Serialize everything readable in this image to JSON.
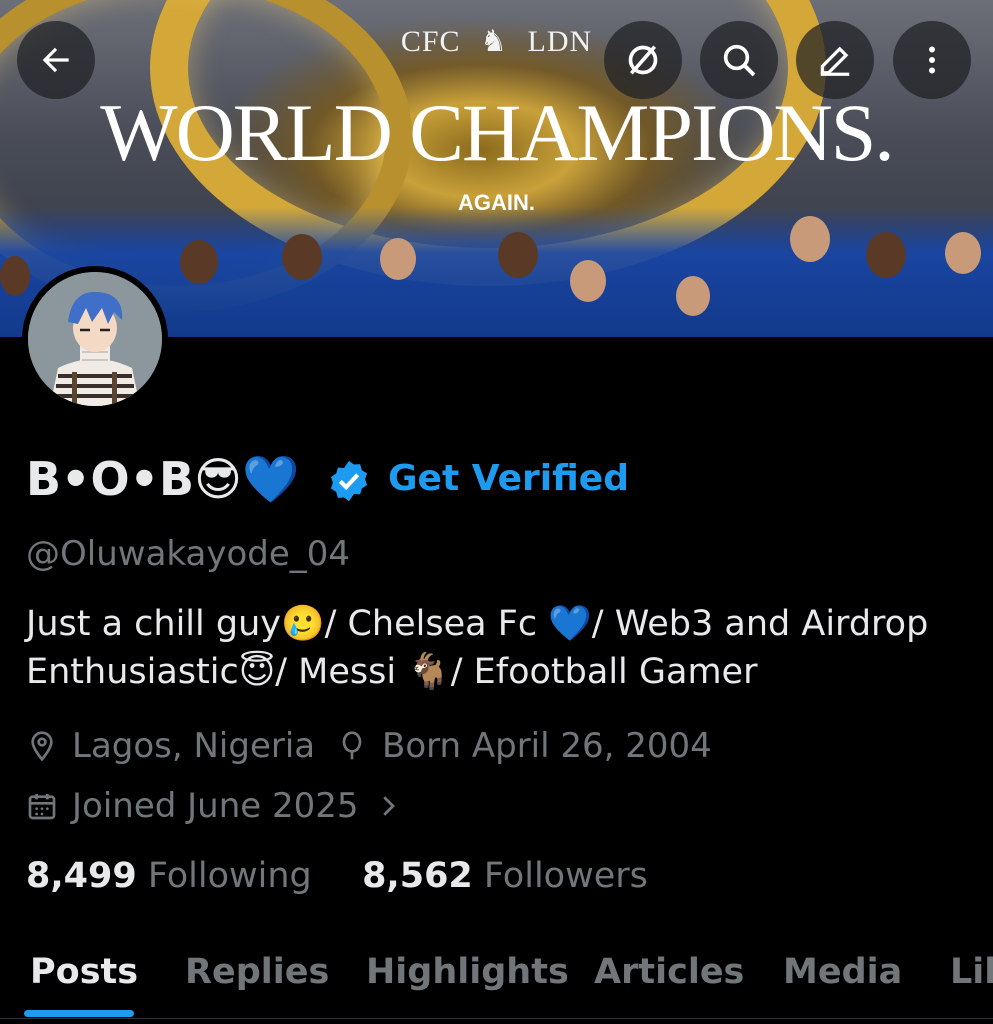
{
  "banner": {
    "brand_left": "CFC",
    "brand_right": "LDN",
    "headline": "WORLD CHAMPIONS.",
    "subline": "AGAIN."
  },
  "toolbar": {
    "back_icon": "arrow-left-icon",
    "grok_icon": "slashed-circle-icon",
    "search_icon": "search-icon",
    "edit_icon": "pencil-icon",
    "more_icon": "more-vertical-icon"
  },
  "profile": {
    "display_name": "B•O•B😎💙",
    "get_verified_label": "Get Verified",
    "handle": "@Oluwakayode_04",
    "bio_line1": "Just a chill guy🥲/ Chelsea Fc 💙/ Web3 and Airdrop",
    "bio_line2": "Enthusiastic😇/ Messi 🐐/ Efootball Gamer",
    "location": "Lagos, Nigeria",
    "birthday": "Born April 26, 2004",
    "joined": "Joined June 2025"
  },
  "stats": {
    "following_count": "8,499",
    "following_label": "Following",
    "followers_count": "8,562",
    "followers_label": "Followers"
  },
  "tabs": [
    {
      "label": "Posts"
    },
    {
      "label": "Replies"
    },
    {
      "label": "Highlights"
    },
    {
      "label": "Articles"
    },
    {
      "label": "Media"
    },
    {
      "label": "Lik"
    }
  ],
  "colors": {
    "accent": "#1d9bf0",
    "background": "#000000",
    "text_primary": "#e7e9ea",
    "text_secondary": "#71767b"
  }
}
